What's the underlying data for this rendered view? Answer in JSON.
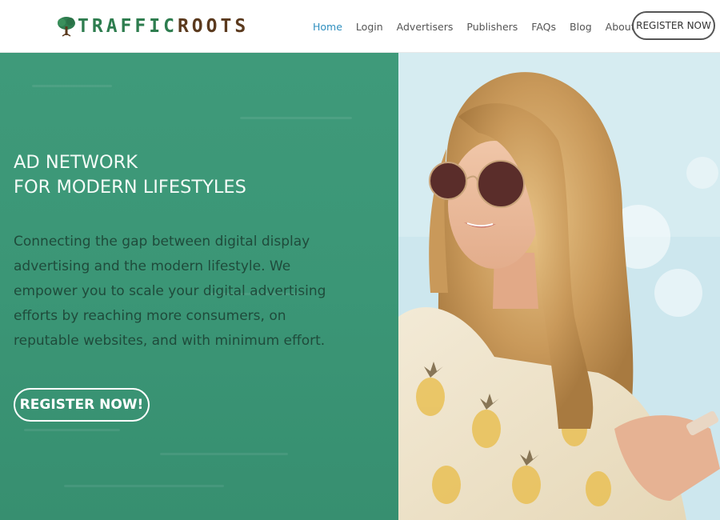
{
  "brand": {
    "part1": "TRAFFIC",
    "part2": "ROOTS",
    "green": "#2e7d4f",
    "brown": "#5b3a1e",
    "icon": "tree-icon"
  },
  "nav": {
    "items": [
      {
        "label": "Home",
        "active": true
      },
      {
        "label": "Login"
      },
      {
        "label": "Advertisers"
      },
      {
        "label": "Publishers"
      },
      {
        "label": "FAQs"
      },
      {
        "label": "Blog"
      },
      {
        "label": "About",
        "icon": "chevron-down-icon"
      }
    ],
    "active_color": "#2f8fbf",
    "cta": "REGISTER NOW"
  },
  "hero": {
    "headline_line1": "AD NETWORK",
    "headline_line2": "FOR MODERN LIFESTYLES",
    "lead": "Connecting the gap between digital display advertising and the modern lifestyle. We empower you to scale your digital advertising efforts by reaching more consumers, on reputable websites, and with minimum effort.",
    "cta": "REGISTER NOW!",
    "panel_color": "#3b9676",
    "photo": "woman-with-sunglasses-and-phone-at-beach"
  }
}
